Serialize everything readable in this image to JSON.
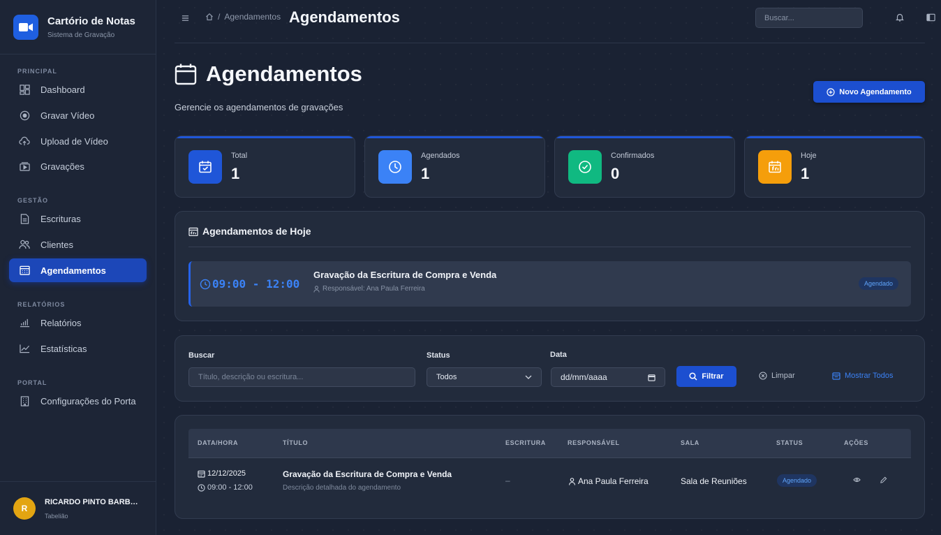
{
  "sidebar": {
    "brand_title": "Cartório de Notas",
    "brand_subtitle": "Sistema de Gravação",
    "sections": {
      "principal": "PRINCIPAL",
      "gestao": "GESTÃO",
      "relatorios": "RELATÓRIOS",
      "portal": "PORTAL"
    },
    "items": {
      "dashboard": "Dashboard",
      "gravar": "Gravar Vídeo",
      "upload": "Upload de Vídeo",
      "gravacoes": "Gravações",
      "escrituras": "Escrituras",
      "clientes": "Clientes",
      "agendamentos": "Agendamentos",
      "relatorios": "Relatórios",
      "estatisticas": "Estatísticas",
      "configuracoes": "Configurações do Porta"
    },
    "active_item": "agendamentos",
    "user": {
      "initial": "R",
      "name": "RICARDO PINTO BARBOSA",
      "role": "Tabelião"
    }
  },
  "topbar": {
    "breadcrumb": "Agendamentos",
    "title": "Agendamentos",
    "search_placeholder": "Buscar..."
  },
  "page": {
    "title": "Agendamentos",
    "subtitle": "Gerencie os agendamentos de gravações",
    "new_button": "Novo Agendamento"
  },
  "stats": [
    {
      "label": "Total",
      "value": "1",
      "color": "#1f56d8"
    },
    {
      "label": "Agendados",
      "value": "1",
      "color": "#3b82f6"
    },
    {
      "label": "Confirmados",
      "value": "0",
      "color": "#10b981"
    },
    {
      "label": "Hoje",
      "value": "1",
      "color": "#f59e0b"
    }
  ],
  "today": {
    "title": "Agendamentos de Hoje",
    "item": {
      "time": "09:00 - 12:00",
      "title": "Gravação da Escritura de Compra e Venda",
      "responsavel": "Responsável: Ana Paula Ferreira",
      "status": "Agendado"
    }
  },
  "filters": {
    "search_label": "Buscar",
    "search_placeholder": "Título, descrição ou escritura...",
    "status_label": "Status",
    "status_value": "Todos",
    "date_label": "Data",
    "date_placeholder": "dd/mm/aaaa",
    "filter_button": "Filtrar",
    "clear_button": "Limpar",
    "show_all_button": "Mostrar Todos"
  },
  "table": {
    "headers": [
      "DATA/HORA",
      "TÍTULO",
      "ESCRITURA",
      "RESPONSÁVEL",
      "SALA",
      "STATUS",
      "AÇÕES"
    ],
    "rows": [
      {
        "date": "12/12/2025",
        "time": "09:00 - 12:00",
        "title": "Gravação da Escritura de Compra e Venda",
        "description": "Descrição detalhada do agendamento",
        "escritura": "–",
        "responsavel": "Ana Paula Ferreira",
        "sala": "Sala de Reuniões",
        "status": "Agendado"
      }
    ]
  },
  "colors": {
    "accent": "#1c4fd0",
    "badge_text": "#60a5fa",
    "avatar": "#e3a512"
  }
}
